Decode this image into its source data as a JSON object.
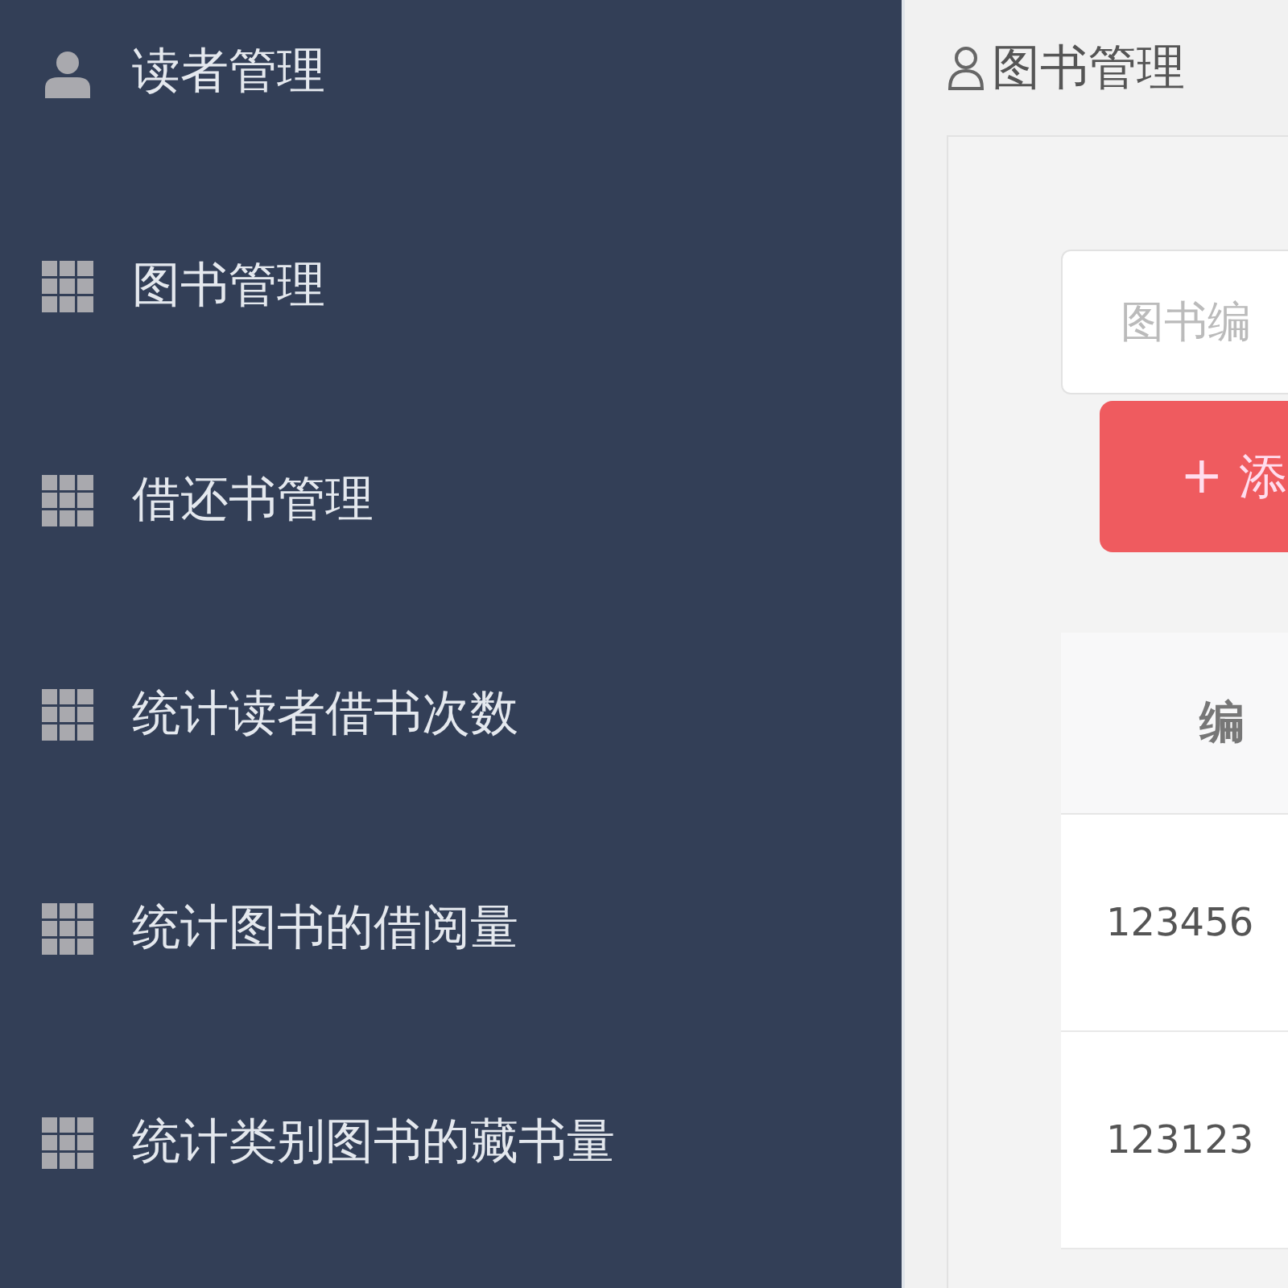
{
  "sidebar": {
    "items": [
      {
        "kind": "person",
        "label": "读者管理"
      },
      {
        "kind": "grid",
        "label": "图书管理"
      },
      {
        "kind": "grid",
        "label": "借还书管理"
      },
      {
        "kind": "grid",
        "label": "统计读者借书次数"
      },
      {
        "kind": "grid",
        "label": "统计图书的借阅量"
      },
      {
        "kind": "grid",
        "label": "统计类别图书的藏书量"
      }
    ]
  },
  "breadcrumb": {
    "label": "图书管理"
  },
  "search": {
    "placeholder": "图书编"
  },
  "add_button": {
    "icon": "+",
    "label": "添"
  },
  "table": {
    "columns": [
      "编"
    ],
    "rows": [
      [
        "123456"
      ],
      [
        "123123"
      ]
    ]
  }
}
